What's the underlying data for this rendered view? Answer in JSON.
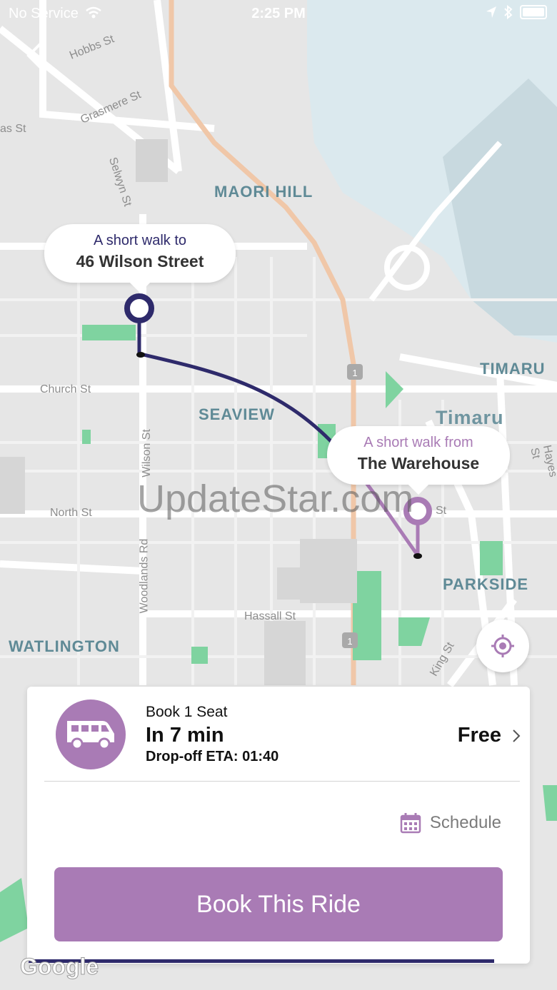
{
  "status_bar": {
    "carrier": "No Service",
    "time": "2:25 PM"
  },
  "map": {
    "places": [
      "MAORI HILL",
      "SEAVIEW",
      "TIMARU",
      "Timaru",
      "PARKSIDE",
      "WATLINGTON"
    ],
    "streets": [
      "Hobbs St",
      "Grasmere St",
      "as St",
      "Selwyn St",
      "Church St",
      "Wilson St",
      "North St",
      "Woodlands Rd",
      "Hassall St",
      "King St",
      "Hayes St",
      "St"
    ],
    "route_colors": {
      "pickup": "#2e2a6b",
      "dropoff": "#a97bb5"
    }
  },
  "pickup_callout": {
    "line1": "A short walk to",
    "line2": "46 Wilson Street"
  },
  "dropoff_callout": {
    "line1": "A short walk from",
    "line2": "The Warehouse"
  },
  "watermark": "UpdateStar.com",
  "booking": {
    "seats": "Book 1 Seat",
    "eta": "In 7 min",
    "dropoff_eta": "Drop-off ETA: 01:40",
    "price": "Free",
    "schedule_label": "Schedule",
    "book_button": "Book This Ride"
  },
  "google_logo": "Google",
  "colors": {
    "accent": "#a97bb5",
    "navy": "#2e2a6b"
  }
}
